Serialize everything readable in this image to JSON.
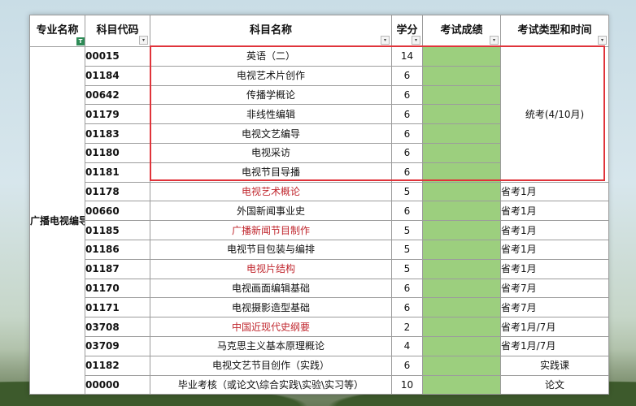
{
  "header": {
    "major": "专业名称",
    "code": "科目代码",
    "name": "科目名称",
    "credit": "学分",
    "score": "考试成绩",
    "type": "考试类型和时间",
    "filter_icon": "▾",
    "tag_icon": "T"
  },
  "major": "广播电视编导本科",
  "merged_type": "统考(4/10月)",
  "rows": [
    {
      "code": "00015",
      "name": "英语（二）",
      "credit": "14",
      "type": ""
    },
    {
      "code": "01184",
      "name": "电视艺术片创作",
      "credit": "6",
      "type": ""
    },
    {
      "code": "00642",
      "name": "传播学概论",
      "credit": "6",
      "type": ""
    },
    {
      "code": "01179",
      "name": "非线性编辑",
      "credit": "6",
      "type": ""
    },
    {
      "code": "01183",
      "name": "电视文艺编导",
      "credit": "6",
      "type": ""
    },
    {
      "code": "01180",
      "name": "电视采访",
      "credit": "6",
      "type": ""
    },
    {
      "code": "01181",
      "name": "电视节目导播",
      "credit": "6",
      "type": ""
    },
    {
      "code": "01178",
      "name": "电视艺术概论",
      "credit": "5",
      "type": "省考1月"
    },
    {
      "code": "00660",
      "name": "外国新闻事业史",
      "credit": "6",
      "type": "省考1月"
    },
    {
      "code": "01185",
      "name": "广播新闻节目制作",
      "credit": "5",
      "type": "省考1月"
    },
    {
      "code": "01186",
      "name": "电视节目包装与编排",
      "credit": "5",
      "type": "省考1月"
    },
    {
      "code": "01187",
      "name": "电视片结构",
      "credit": "5",
      "type": "省考1月"
    },
    {
      "code": "01170",
      "name": "电视画面编辑基础",
      "credit": "6",
      "type": "省考7月"
    },
    {
      "code": "01171",
      "name": "电视摄影造型基础",
      "credit": "6",
      "type": "省考7月"
    },
    {
      "code": "03708",
      "name": "中国近现代史纲要",
      "credit": "2",
      "type": "省考1月/7月"
    },
    {
      "code": "03709",
      "name": "马克思主义基本原理概论",
      "credit": "4",
      "type": "省考1月/7月"
    },
    {
      "code": "01182",
      "name": "电视文艺节目创作（实践）",
      "credit": "6",
      "type": "实践课"
    },
    {
      "code": "00000",
      "name": "毕业考核（或论文\\综合实践\\实验\\实习等）",
      "credit": "10",
      "type": "论文"
    }
  ],
  "colors": {
    "score_fill": "#9ccf7e",
    "score_header": "#ffff66",
    "red_text": "#c0262d",
    "highlight_border": "#e0333a"
  }
}
